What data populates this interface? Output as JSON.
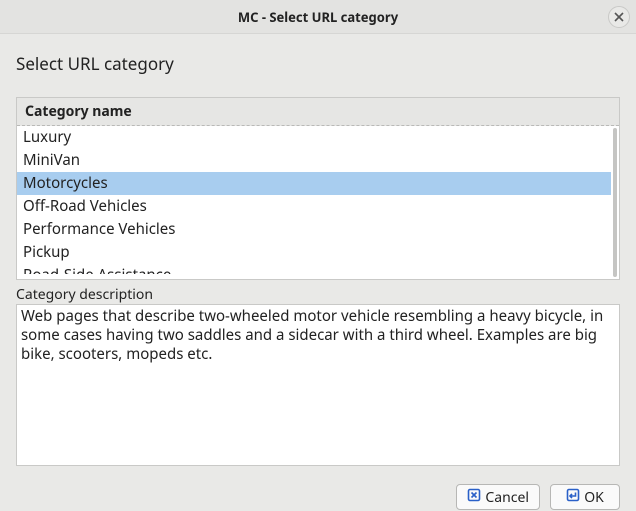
{
  "window": {
    "title": "MC - Select URL category"
  },
  "heading": "Select URL category",
  "list": {
    "header": "Category name",
    "items": [
      {
        "label": "Luxury",
        "selected": false
      },
      {
        "label": "MiniVan",
        "selected": false
      },
      {
        "label": "Motorcycles",
        "selected": true
      },
      {
        "label": "Off-Road Vehicles",
        "selected": false
      },
      {
        "label": "Performance Vehicles",
        "selected": false
      },
      {
        "label": "Pickup",
        "selected": false
      },
      {
        "label": "Road-Side Assistance",
        "selected": false,
        "partial": true
      }
    ]
  },
  "description": {
    "label": "Category description",
    "text": "Web pages that describe two-wheeled motor vehicle resembling a heavy bicycle, in some cases having two saddles and a sidecar with a third wheel. Examples are big bike, scooters, mopeds etc."
  },
  "buttons": {
    "cancel": "Cancel",
    "ok": "OK"
  }
}
